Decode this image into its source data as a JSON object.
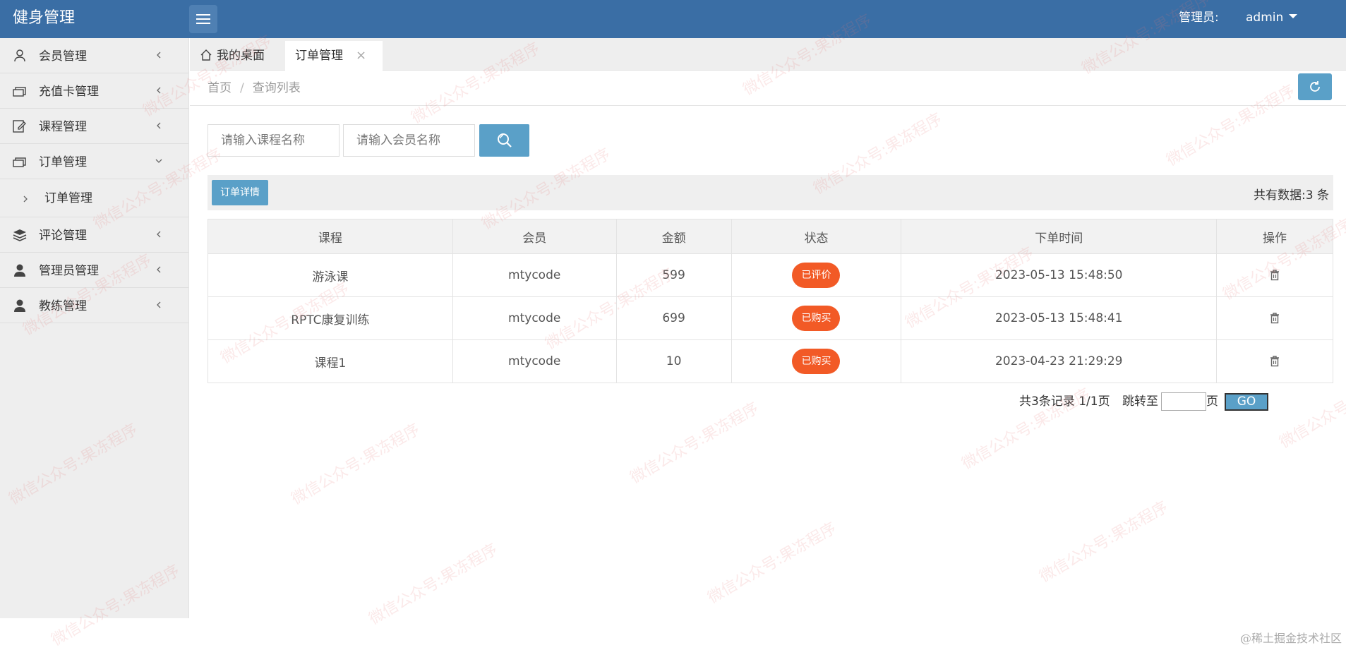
{
  "header": {
    "title": "健身管理",
    "admin_label": "管理员:",
    "admin_user": "admin"
  },
  "sidebar": {
    "items": [
      {
        "label": "会员管理",
        "icon": "user-icon"
      },
      {
        "label": "充值卡管理",
        "icon": "card-icon"
      },
      {
        "label": "课程管理",
        "icon": "edit-icon"
      },
      {
        "label": "订单管理",
        "icon": "card-icon",
        "expanded": true
      },
      {
        "label": "评论管理",
        "icon": "layers-icon"
      },
      {
        "label": "管理员管理",
        "icon": "person-icon"
      },
      {
        "label": "教练管理",
        "icon": "person-icon"
      }
    ],
    "sub_items": [
      {
        "label": "订单管理"
      }
    ]
  },
  "tabs": {
    "home": "我的桌面",
    "active": "订单管理",
    "close": "×"
  },
  "breadcrumb": {
    "home": "首页",
    "sep": "/",
    "current": "查询列表"
  },
  "search": {
    "course_placeholder": "请输入课程名称",
    "member_placeholder": "请输入会员名称"
  },
  "toolbar": {
    "detail_label": "订单详情",
    "total_text": "共有数据:3 条"
  },
  "table": {
    "headers": [
      "课程",
      "会员",
      "金额",
      "状态",
      "下单时间",
      "操作"
    ],
    "rows": [
      {
        "course": "游泳课",
        "member": "mtycode",
        "amount": "599",
        "status": "已评价",
        "time": "2023-05-13 15:48:50"
      },
      {
        "course": "RPTC康复训练",
        "member": "mtycode",
        "amount": "699",
        "status": "已购买",
        "time": "2023-05-13 15:48:41"
      },
      {
        "course": "课程1",
        "member": "mtycode",
        "amount": "10",
        "status": "已购买",
        "time": "2023-04-23 21:29:29"
      }
    ]
  },
  "pager": {
    "info": "共3条记录  1/1页",
    "jump_label": "跳转至",
    "unit": "页",
    "go": "GO"
  },
  "watermark": "微信公众号:果冻程序",
  "footer_mark": "@稀土掘金技术社区",
  "colors": {
    "header_bg": "#3a6ea5",
    "accent": "#5aa0c8",
    "badge": "#f25a26"
  }
}
